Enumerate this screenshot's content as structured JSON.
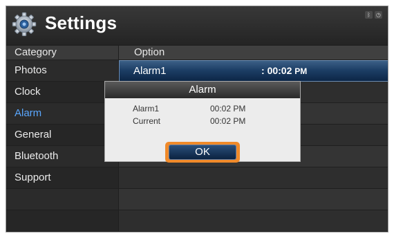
{
  "header": {
    "title": "Settings",
    "status_icons": [
      "bluetooth-icon",
      "clock-icon"
    ]
  },
  "columns": {
    "category": "Category",
    "option": "Option"
  },
  "categories": [
    "Photos",
    "Clock",
    "Alarm",
    "General",
    "Bluetooth",
    "Support"
  ],
  "active_category": "Alarm",
  "option_row": {
    "label": "Alarm1",
    "separator": ":",
    "time": "00:02",
    "ampm": "PM"
  },
  "dialog": {
    "title": "Alarm",
    "rows": [
      {
        "label": "Alarm1",
        "value": "00:02 PM"
      },
      {
        "label": "Current",
        "value": "00:02 PM"
      }
    ],
    "ok_label": "OK"
  },
  "colors": {
    "accent_blue": "#5aa7ff",
    "focus_orange": "#f08a2a"
  }
}
